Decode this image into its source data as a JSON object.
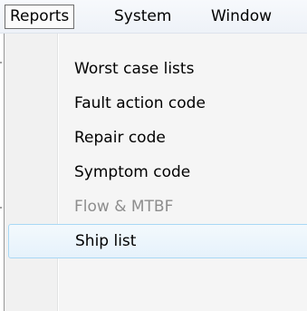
{
  "menubar": {
    "items": [
      {
        "label": "Reports",
        "active": true
      },
      {
        "label": "System"
      },
      {
        "label": "Window"
      }
    ]
  },
  "dropdown": {
    "items": [
      {
        "label": "Worst case lists",
        "enabled": true
      },
      {
        "label": "Fault action code",
        "enabled": true
      },
      {
        "label": "Repair code",
        "enabled": true
      },
      {
        "label": "Symptom code",
        "enabled": true
      },
      {
        "label": "Flow & MTBF",
        "enabled": false
      },
      {
        "label": "Ship list",
        "enabled": true,
        "hovered": true
      }
    ]
  },
  "colors": {
    "hover_border": "#a8d8f5",
    "disabled_text": "#8d8d8d",
    "menu_background": "#f5f5f5"
  }
}
